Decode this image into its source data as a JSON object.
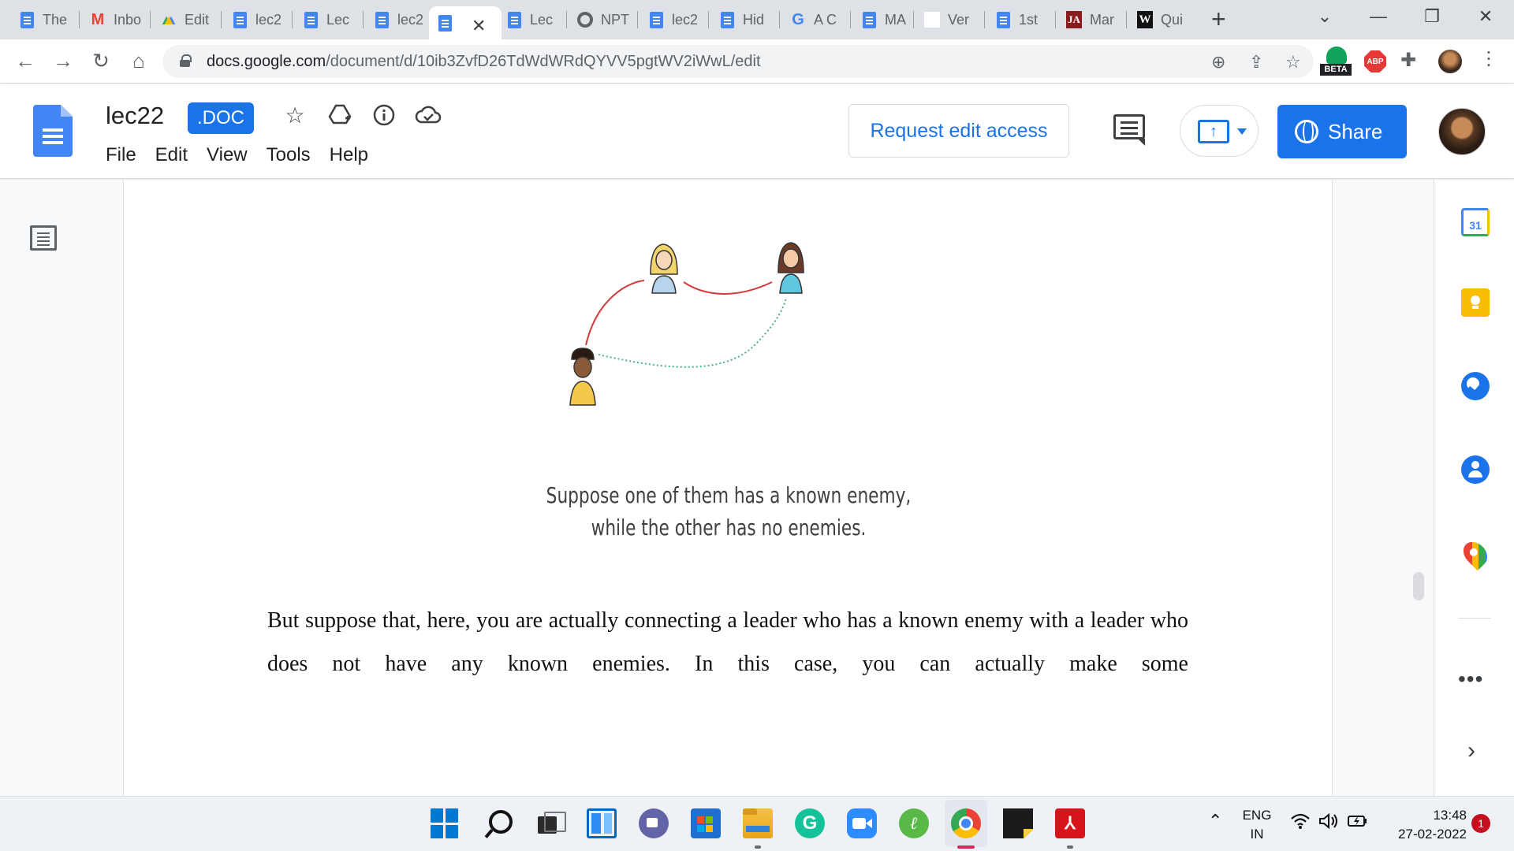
{
  "tabs": [
    {
      "label": "The",
      "icon": "docs-icon"
    },
    {
      "label": "Inbo",
      "icon": "gmail-icon"
    },
    {
      "label": "Edit",
      "icon": "drive-icon"
    },
    {
      "label": "lec2",
      "icon": "docs-icon"
    },
    {
      "label": "Lec",
      "icon": "docs-icon"
    },
    {
      "label": "lec2",
      "icon": "docs-icon"
    },
    {
      "label": "",
      "icon": "docs-icon",
      "active": true
    },
    {
      "label": "Lec",
      "icon": "docs-icon"
    },
    {
      "label": "NPT",
      "icon": "globe-icon"
    },
    {
      "label": "lec2",
      "icon": "docs-icon"
    },
    {
      "label": "Hid",
      "icon": "docs-icon"
    },
    {
      "label": "A C",
      "icon": "google-icon"
    },
    {
      "label": "MA",
      "icon": "docs-icon"
    },
    {
      "label": "Ver",
      "icon": "blank-icon"
    },
    {
      "label": "1st",
      "icon": "docs-icon"
    },
    {
      "label": "Mar",
      "icon": "ja-icon"
    },
    {
      "label": "Qui",
      "icon": "w-icon"
    }
  ],
  "tab_badges": {
    "ja": "JA",
    "w": "W"
  },
  "browser": {
    "url_host": "docs.google.com",
    "url_path": "/document/d/10ib3ZvfD26TdWdWRdQYVV5pgtWV2iWwL/edit",
    "beta_label": "BETA",
    "abp_label": "ABP"
  },
  "doc": {
    "title": "lec22",
    "badge": ".DOC",
    "menu": [
      "File",
      "Edit",
      "View",
      "Tools",
      "Help"
    ],
    "request_edit": "Request edit access",
    "share_label": "Share"
  },
  "content": {
    "caption_line1": "Suppose one of them has a known enemy,",
    "caption_line2": "while the other has no enemies.",
    "body": "But suppose that, here, you are actually connecting a leader who has a known enemy with a leader who does not have any known enemies. In this case, you can actually make some"
  },
  "sidepanel": {
    "calendar_day": "31",
    "more": "•••"
  },
  "taskbar": {
    "lang_line1": "ENG",
    "lang_line2": "IN",
    "time": "13:48",
    "date": "27-02-2022",
    "notifications": "1",
    "grammarly": "G"
  },
  "colors": {
    "accent": "#1a73e8",
    "enemy_edge": "#d23b3b",
    "neutral_edge": "#4caf8a"
  }
}
